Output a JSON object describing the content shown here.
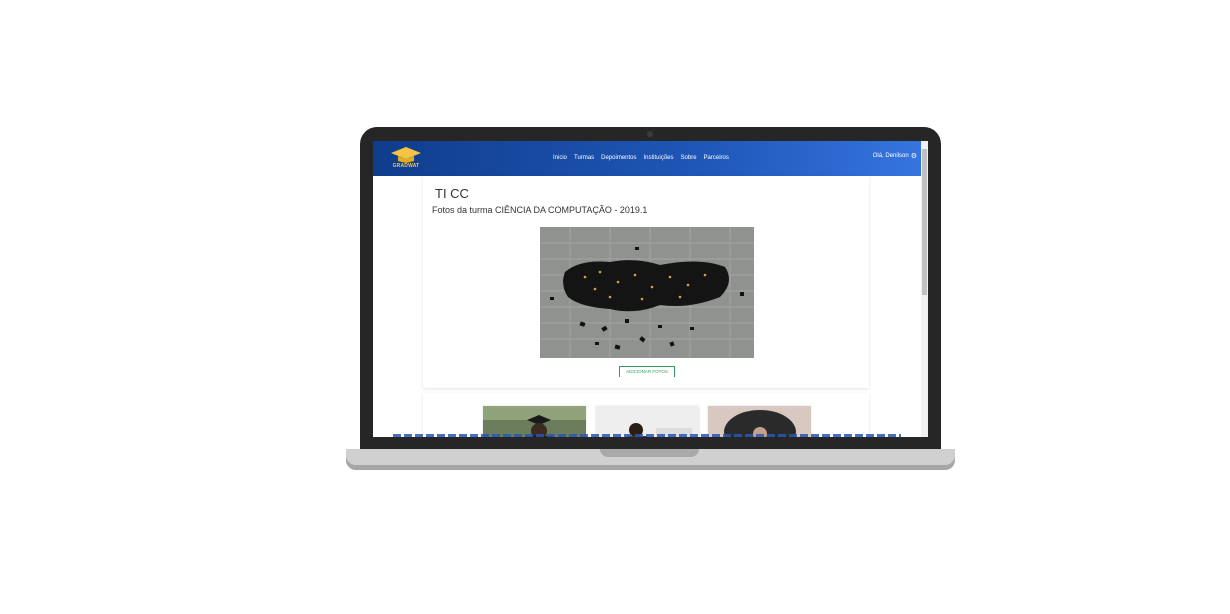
{
  "logo": {
    "text": "GRADWAT"
  },
  "nav": {
    "links": [
      "Inicio",
      "Turmas",
      "Depoimentos",
      "Instituições",
      "Sobre",
      "Parceiros"
    ],
    "user": "Olá, Denilson"
  },
  "page": {
    "title": "TI CC",
    "subtitle": "Fotos da turma CIÊNCIA DA COMPUTAÇÃO - 2019.1",
    "add_photo_label": "ADICIONAR FOTOS"
  },
  "colors": {
    "navbar_start": "#0f3d8c",
    "navbar_end": "#3674e0",
    "accent_green": "#2e9d5b"
  }
}
